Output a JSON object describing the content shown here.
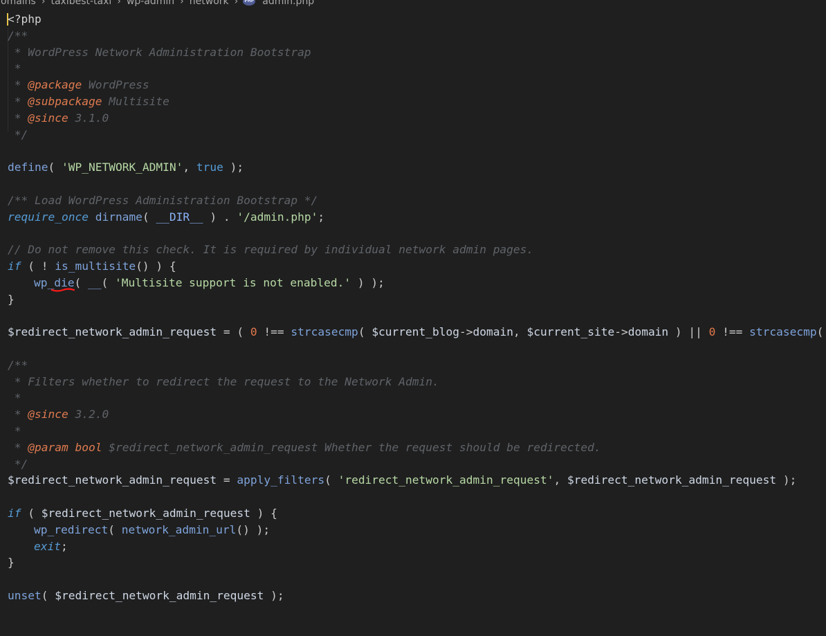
{
  "breadcrumb": {
    "items": [
      "omains",
      "taxibest-taxi",
      "wp-admin",
      "network"
    ],
    "file_icon": "php-file-icon",
    "file_icon_text": "PHP",
    "file_name": "admin.php",
    "separator_icon": "chevron-right-icon"
  },
  "code": {
    "l01": "<?php",
    "l02": "/**",
    "l03": " * WordPress Network Administration Bootstrap",
    "l04": " *",
    "l05_pre": " * ",
    "l05_tag": "@package",
    "l05_val": " WordPress",
    "l06_pre": " * ",
    "l06_tag": "@subpackage",
    "l06_val": " Multisite",
    "l07_pre": " * ",
    "l07_tag": "@since",
    "l07_val": " 3.1.0",
    "l08": " */",
    "l10_fn": "define",
    "l10_a": "( ",
    "l10_str": "'WP_NETWORK_ADMIN'",
    "l10_b": ", ",
    "l10_kw": "true",
    "l10_c": " );",
    "l12": "/** Load WordPress Administration Bootstrap */",
    "l13_kw": "require_once",
    "l13_a": " ",
    "l13_fn": "dirname",
    "l13_b": "( ",
    "l13_const": "__DIR__",
    "l13_c": " ) . ",
    "l13_str": "'/admin.php'",
    "l13_d": ";",
    "l15": "// Do not remove this check. It is required by individual network admin pages.",
    "l16_kw": "if",
    "l16_a": " ( ! ",
    "l16_fn": "is_multisite",
    "l16_b": "() ) {",
    "l17_fn": "wp_die",
    "l17_a": "( ",
    "l17_fn2": "__",
    "l17_b": "( ",
    "l17_str": "'Multisite support is not enabled.'",
    "l17_c": " ) );",
    "l18": "}",
    "l20_var": "$redirect_network_admin_request",
    "l20_a": " = ( ",
    "l20_num": "0",
    "l20_b": " !== ",
    "l20_fn": "strcasecmp",
    "l20_c": "( ",
    "l20_var2": "$current_blog",
    "l20_d": "->",
    "l20_prop": "domain",
    "l20_e": ", ",
    "l20_var3": "$current_site",
    "l20_f": "->",
    "l20_prop2": "domain",
    "l20_g": " ) || ",
    "l20_num2": "0",
    "l20_h": " !== ",
    "l20_fn2": "strcasecmp",
    "l20_i": "( ",
    "l20_var4": "$",
    "l22": "/**",
    "l23": " * Filters whether to redirect the request to the Network Admin.",
    "l24": " *",
    "l25_pre": " * ",
    "l25_tag": "@since",
    "l25_val": " 3.2.0",
    "l26": " *",
    "l27_pre": " * ",
    "l27_tag": "@param",
    "l27_type": " bool",
    "l27_val": " $redirect_network_admin_request Whether the request should be redirected.",
    "l28": " */",
    "l29_var": "$redirect_network_admin_request",
    "l29_a": " = ",
    "l29_fn": "apply_filters",
    "l29_b": "( ",
    "l29_str": "'redirect_network_admin_request'",
    "l29_c": ", ",
    "l29_var2": "$redirect_network_admin_request",
    "l29_d": " );",
    "l31_kw": "if",
    "l31_a": " ( ",
    "l31_var": "$redirect_network_admin_request",
    "l31_b": " ) {",
    "l32_fn": "wp_redirect",
    "l32_a": "( ",
    "l32_fn2": "network_admin_url",
    "l32_b": "() );",
    "l33_kw": "exit",
    "l33_a": ";",
    "l34": "}",
    "l36_fn": "unset",
    "l36_a": "( ",
    "l36_var": "$redirect_network_admin_request",
    "l36_b": " );"
  }
}
